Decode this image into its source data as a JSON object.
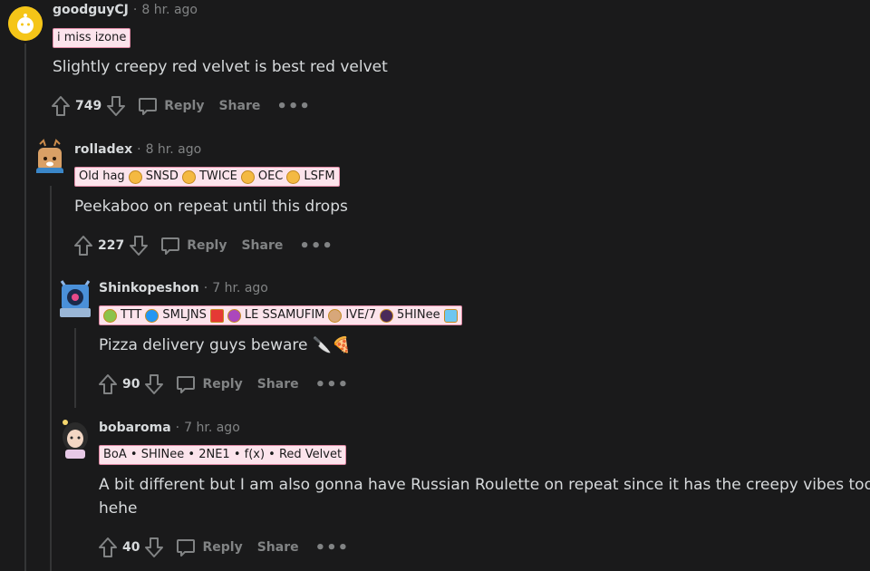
{
  "comments": [
    {
      "author": "goodguyCJ",
      "time": "8 hr. ago",
      "flair": [
        "i miss izone"
      ],
      "body": [
        "Slightly creepy red velvet is best red velvet"
      ],
      "score": "749",
      "reply_label": "Reply",
      "share_label": "Share",
      "avatar_color": "#f5c518"
    },
    {
      "author": "rolladex",
      "time": "8 hr. ago",
      "flair": [
        "Old hag",
        "SNSD",
        "TWICE",
        "OEC",
        "LSFM"
      ],
      "body": [
        "Peekaboo on repeat until this drops"
      ],
      "score": "227",
      "reply_label": "Reply",
      "share_label": "Share",
      "avatar_color": "#c98a4b"
    },
    {
      "author": "Shinkopeshon",
      "time": "7 hr. ago",
      "flair": [
        "TTT",
        "SMLJNS",
        "LE SSAMUFIM",
        "IVE/7",
        "5HINee"
      ],
      "body": [
        "Pizza delivery guys beware 🔪🍕"
      ],
      "score": "90",
      "reply_label": "Reply",
      "share_label": "Share",
      "avatar_color": "#4a90d9"
    },
    {
      "author": "bobaroma",
      "time": "7 hr. ago",
      "flair": [
        "BoA • SHINee • 2NE1 • f(x) • Red Velvet"
      ],
      "body": [
        "A bit different but I am also gonna have Russian Roulette on repeat since it has the creepy vibes too",
        "hehe"
      ],
      "score": "40",
      "reply_label": "Reply",
      "share_label": "Share",
      "avatar_color": "#e7c9e6"
    }
  ],
  "more_label": "•••",
  "colors": {
    "background": "#1a1a1b",
    "text": "#d7dadc",
    "muted": "#818384",
    "thread_line": "#343536",
    "flair_bg": "#fce4ec"
  }
}
